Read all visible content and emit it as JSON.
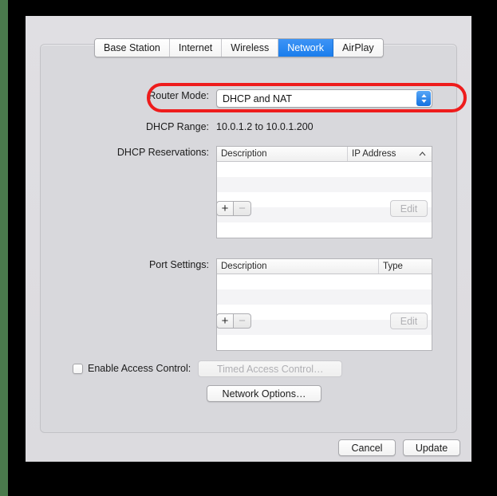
{
  "window": {
    "tabs": [
      {
        "label": "Base Station",
        "selected": false
      },
      {
        "label": "Internet",
        "selected": false
      },
      {
        "label": "Wireless",
        "selected": false
      },
      {
        "label": "Network",
        "selected": true
      },
      {
        "label": "AirPlay",
        "selected": false
      }
    ]
  },
  "router_mode": {
    "label": "Router Mode:",
    "selected_value": "DHCP and NAT",
    "stepper_icon": "chevron-up-down-icon",
    "highlight_color": "#ee1c1c",
    "accent_color": "#1a7dec"
  },
  "dhcp_range": {
    "label": "DHCP Range:",
    "value": "10.0.1.2 to 10.0.1.200"
  },
  "dhcp_reservations": {
    "label": "DHCP Reservations:",
    "columns": [
      "Description",
      "IP Address"
    ],
    "sort_indicator": "sort-ascending-caret-icon",
    "rows": [],
    "empty_row_count": 5,
    "add_label": "+",
    "remove_label": "−",
    "edit_label": "Edit",
    "add_enabled": true,
    "remove_enabled": false,
    "edit_enabled": false
  },
  "port_settings": {
    "label": "Port Settings:",
    "columns": [
      "Description",
      "Type"
    ],
    "rows": [],
    "empty_row_count": 5,
    "add_label": "+",
    "remove_label": "−",
    "edit_label": "Edit",
    "add_enabled": true,
    "remove_enabled": false,
    "edit_enabled": false
  },
  "access_control": {
    "checkbox_label": "Enable Access Control:",
    "checked": false,
    "button_label": "Timed Access Control…",
    "button_enabled": false
  },
  "network_options": {
    "button_label": "Network Options…"
  },
  "footer": {
    "cancel_label": "Cancel",
    "update_label": "Update"
  }
}
